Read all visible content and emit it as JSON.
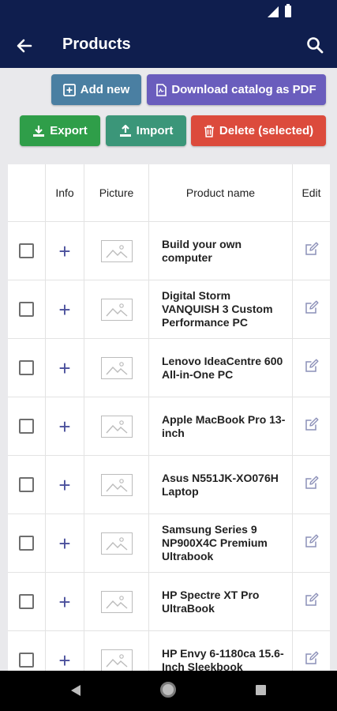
{
  "app_bar": {
    "title": "Products",
    "back_icon": "arrow-back-icon",
    "search_icon": "search-icon",
    "background": "#0f1e4e"
  },
  "actions": {
    "add_new": {
      "label": "Add new",
      "icon": "plus-square-icon",
      "color": "#4a7fa2"
    },
    "download_pdf": {
      "label": "Download catalog as PDF",
      "icon": "pdf-file-icon",
      "color": "#6a5dbd"
    },
    "export": {
      "label": "Export",
      "icon": "download-icon",
      "color": "#2f9e49"
    },
    "import": {
      "label": "Import",
      "icon": "upload-icon",
      "color": "#3b9679"
    },
    "delete_selected": {
      "label": "Delete (selected)",
      "icon": "trash-icon",
      "color": "#dc4b3c"
    }
  },
  "table": {
    "headers": {
      "select": "",
      "info": "Info",
      "picture": "Picture",
      "name": "Product name",
      "edit": "Edit"
    },
    "rows": [
      {
        "name": "Build your own computer"
      },
      {
        "name": "Digital Storm VANQUISH 3 Custom Performance PC"
      },
      {
        "name": "Lenovo IdeaCentre 600 All-in-One PC"
      },
      {
        "name": "Apple MacBook Pro 13-inch"
      },
      {
        "name": "Asus N551JK-XO076H Laptop"
      },
      {
        "name": "Samsung Series 9 NP900X4C Premium Ultrabook"
      },
      {
        "name": "HP Spectre XT Pro UltraBook"
      },
      {
        "name": "HP Envy 6-1180ca 15.6-Inch Sleekbook"
      }
    ]
  }
}
